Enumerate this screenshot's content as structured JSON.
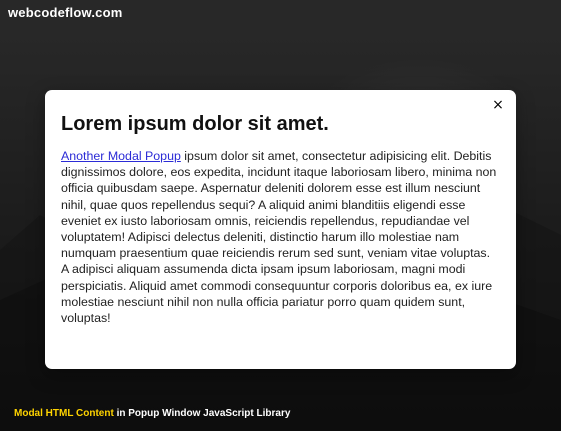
{
  "watermark": {
    "text": "webcodeflow.com"
  },
  "modal": {
    "title": "Lorem ipsum dolor sit amet.",
    "close_label": "×",
    "link_text": "Another Modal Popup",
    "body_text": " ipsum dolor sit amet, consectetur adipisicing elit. Debitis dignissimos dolore, eos expedita, incidunt itaque laboriosam libero, minima non officia quibusdam saepe. Aspernatur deleniti dolorem esse est illum nesciunt nihil, quae quos repellendus sequi? A aliquid animi blanditiis eligendi esse eveniet ex iusto laboriosam omnis, reiciendis repellendus, repudiandae vel voluptatem! Adipisci delectus deleniti, distinctio harum illo molestiae nam numquam praesentium quae reiciendis rerum sed sunt, veniam vitae voluptas. A adipisci aliquam assumenda dicta ipsam ipsum laboriosam, magni modi perspiciatis. Aliquid amet commodi consequuntur corporis doloribus ea, ex iure molestiae nesciunt nihil non nulla officia pariatur porro quam quidem sunt, voluptas!"
  },
  "caption": {
    "accent": "Modal HTML Content",
    "rest": " in Popup Window JavaScript Library"
  },
  "colors": {
    "link": "#2b2bd6",
    "caption_accent": "#ffd400",
    "overlay_bg": "#1f1f1f",
    "modal_bg": "#ffffff"
  },
  "icons": {
    "close": "close-icon"
  }
}
